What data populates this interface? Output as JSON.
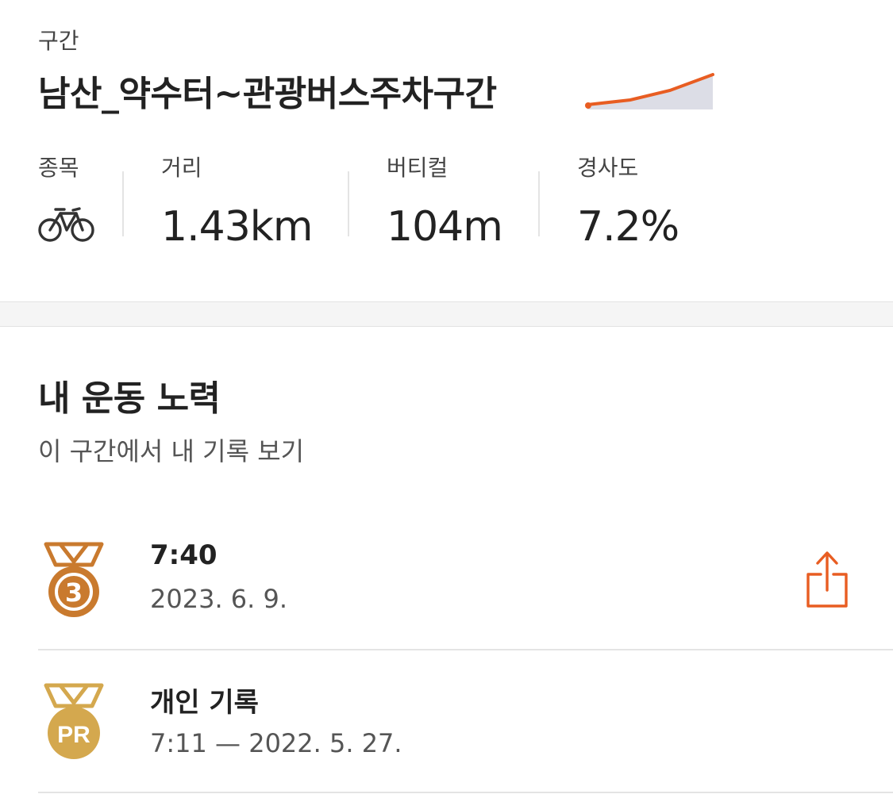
{
  "segment": {
    "label": "구간",
    "name": "남산_약수터~관광버스주차구간",
    "elevation_profile": {
      "line_color": "#e85d22",
      "fill_color": "#dcdde6"
    }
  },
  "stats": {
    "sport": {
      "label": "종목",
      "icon": "bike-icon"
    },
    "distance": {
      "label": "거리",
      "value": "1.43km"
    },
    "vertical": {
      "label": "버티컬",
      "value": "104m"
    },
    "grade": {
      "label": "경사도",
      "value": "7.2%"
    }
  },
  "efforts": {
    "heading": "내 운동 노력",
    "subtitle": "이 구간에서 내 기록 보기",
    "items": [
      {
        "medal": "bronze-medal-icon",
        "medal_text": "3",
        "medal_color": "#c97a2e",
        "primary": "7:40",
        "secondary": "2023. 6. 9.",
        "action": "share-icon"
      },
      {
        "medal": "pr-medal-icon",
        "medal_text": "PR",
        "medal_color": "#d4a84e",
        "primary": "개인 기록",
        "secondary": "7:11 — 2022. 5. 27."
      }
    ]
  },
  "colors": {
    "accent": "#e85d22",
    "text_primary": "#222222",
    "text_secondary": "#555555",
    "divider": "#e4e4e4"
  }
}
